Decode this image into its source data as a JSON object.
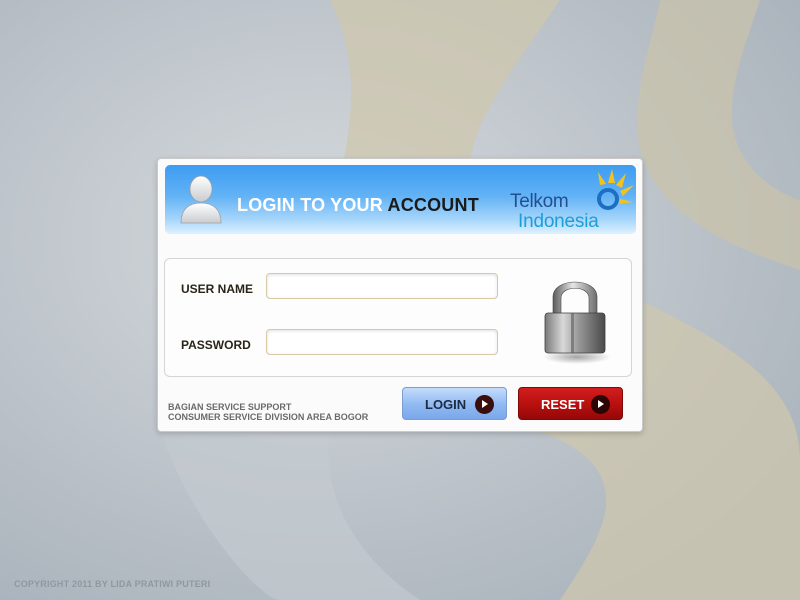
{
  "header": {
    "title_prefix": "LOGIN TO YOUR",
    "title_accent": "ACCOUNT",
    "avatar_icon": "user-avatar-icon"
  },
  "brand": {
    "line1": "Telkom",
    "line2": "Indonesia",
    "colors": {
      "navy": "#234f8f",
      "cyan": "#1c9ed8",
      "sun": "#f4c21f"
    }
  },
  "form": {
    "username": {
      "label": "USER NAME",
      "value": "",
      "placeholder": ""
    },
    "password": {
      "label": "PASSWORD",
      "value": "",
      "placeholder": ""
    },
    "lock_icon": "padlock-icon"
  },
  "footer": {
    "line1": "BAGIAN SERVICE SUPPORT",
    "line2": "CONSUMER SERVICE DIVISION AREA BOGOR"
  },
  "buttons": {
    "login": {
      "label": "LOGIN",
      "icon": "arrow-right-icon",
      "color": "#8fb9f2"
    },
    "reset": {
      "label": "RESET",
      "icon": "arrow-right-icon",
      "color": "#b70f0f"
    }
  },
  "copyright": "COPYRIGHT 2011 BY LIDA PRATIWI PUTERI"
}
